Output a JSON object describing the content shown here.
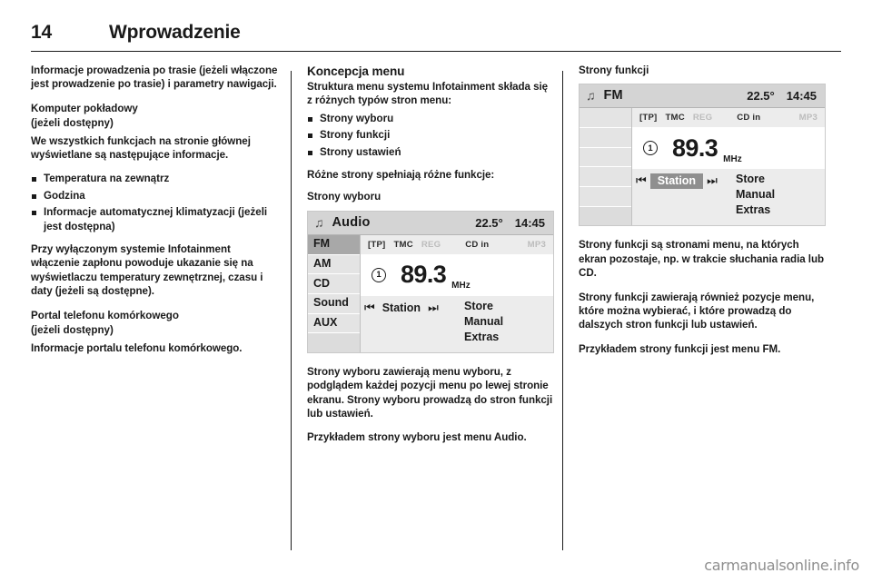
{
  "header": {
    "page_number": "14",
    "title": "Wprowadzenie"
  },
  "left_column": {
    "intro_paragraph": "Informacje prowadzenia po trasie (jeżeli włączone jest prowadzenie po trasie) i parametry nawigacji.",
    "section_1_title": "Komputer pokładowy",
    "section_1_subtitle": "(jeżeli dostępny)",
    "section_1_intro": "We wszystkich funkcjach na stronie głównej wyświetlane są następujące informacje.",
    "bullets": [
      "Temperatura na zewnątrz",
      "Godzina",
      "Informacje automatycznej klimatyzacji (jeżeli jest dostępna)"
    ],
    "paragraph_2": "Przy wyłączonym systemie Infotainment włączenie zapłonu powoduje ukazanie się na wyświetlaczu temperatury zewnętrznej, czasu i daty (jeżeli są dostępne).",
    "section_2_title": "Portal telefonu komórkowego",
    "section_2_subtitle": "(jeżeli dostępny)",
    "section_2_text": "Informacje portalu telefonu komórkowego."
  },
  "mid_column": {
    "section_title": "Koncepcja menu",
    "intro": "Struktura menu systemu Infotainment składa się z różnych typów stron menu:",
    "bullets": [
      "Strony wyboru",
      "Strony funkcji",
      "Strony ustawień"
    ],
    "after_bullets": "Różne strony spełniają różne funkcje:",
    "sub_title": "Strony wyboru",
    "paragraph_1": "Strony wyboru zawierają menu wyboru, z podglądem każdej pozycji menu po lewej stronie ekranu. Strony wyboru prowadzą do stron funkcji lub ustawień.",
    "paragraph_2": "Przykładem strony wyboru jest menu Audio."
  },
  "right_column": {
    "sub_title": "Strony funkcji",
    "paragraph_1": "Strony funkcji są stronami menu, na których ekran pozostaje, np. w trakcie słuchania radia lub CD.",
    "paragraph_2": "Strony funkcji zawierają również pozycje menu, które można wybierać, i które prowadzą do dalszych stron funkcji lub ustawień.",
    "paragraph_3": "Przykładem strony funkcji jest menu FM."
  },
  "screen_audio": {
    "icon": "music-note-icon",
    "mode": "Audio",
    "temperature": "22.5°",
    "time": "14:45",
    "sidebar": [
      {
        "label": "FM",
        "selected": true
      },
      {
        "label": "AM",
        "selected": false
      },
      {
        "label": "CD",
        "selected": false
      },
      {
        "label": "Sound",
        "selected": false
      },
      {
        "label": "AUX",
        "selected": false
      }
    ],
    "status": [
      {
        "label": "[TP]",
        "dim": false
      },
      {
        "label": "TMC",
        "dim": false
      },
      {
        "label": "REG",
        "dim": true
      },
      {
        "label": "CD in",
        "dim": false
      },
      {
        "label": "MP3",
        "dim": true
      }
    ],
    "preset": "1",
    "frequency": "89.3",
    "frequency_unit": "MHz",
    "prev_icon": "skip-previous-icon",
    "next_icon": "skip-next-icon",
    "station_label": "Station",
    "station_highlighted": false,
    "menu_items": [
      "Store",
      "Manual",
      "Extras"
    ]
  },
  "screen_fm": {
    "icon": "music-note-icon",
    "mode": "FM",
    "temperature": "22.5°",
    "time": "14:45",
    "sidebar": [
      {
        "label": "",
        "selected": false
      },
      {
        "label": "",
        "selected": false
      },
      {
        "label": "",
        "selected": false
      },
      {
        "label": "",
        "selected": false
      },
      {
        "label": "",
        "selected": false
      }
    ],
    "status": [
      {
        "label": "[TP]",
        "dim": false
      },
      {
        "label": "TMC",
        "dim": false
      },
      {
        "label": "REG",
        "dim": true
      },
      {
        "label": "CD in",
        "dim": false
      },
      {
        "label": "MP3",
        "dim": true
      }
    ],
    "preset": "1",
    "frequency": "89.3",
    "frequency_unit": "MHz",
    "prev_icon": "skip-previous-icon",
    "next_icon": "skip-next-icon",
    "station_label": "Station",
    "station_highlighted": true,
    "menu_items": [
      "Store",
      "Manual",
      "Extras"
    ]
  },
  "watermark": {
    "text": "carmanualsonline.info"
  },
  "colors": {
    "text": "#1a1a1a",
    "screen_bar": "#d4d4d4",
    "screen_panel": "#ececec",
    "selected": "#a8a8a8",
    "highlight": "#8f8f8f",
    "dim_text": "#bcbcbc",
    "watermark": "#8e8e8e"
  }
}
